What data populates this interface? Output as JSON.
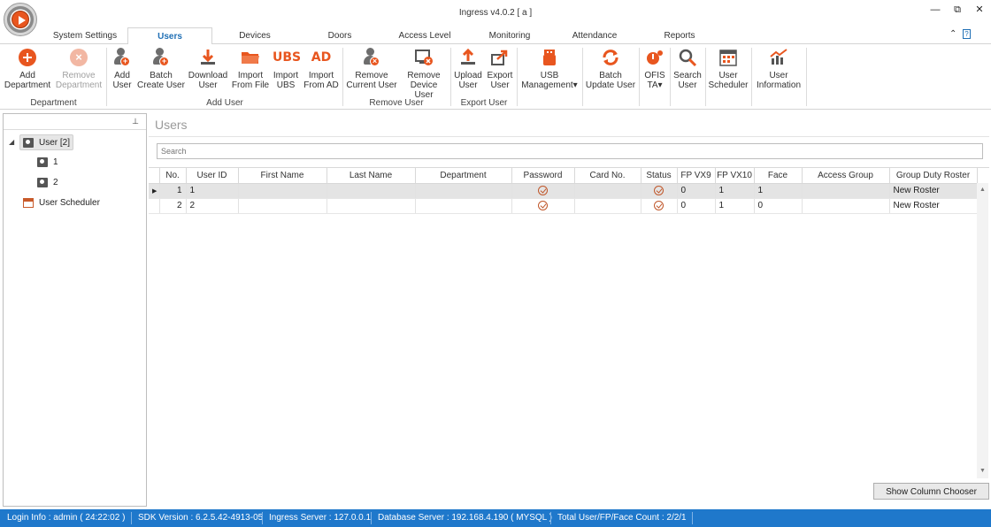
{
  "window": {
    "title": "Ingress v4.0.2 [ a ]",
    "controls": [
      "—",
      "⧉",
      "✕"
    ]
  },
  "tabs": [
    {
      "label": "System Settings",
      "active": false
    },
    {
      "label": "Users",
      "active": true
    },
    {
      "label": "Devices",
      "active": false
    },
    {
      "label": "Doors",
      "active": false
    },
    {
      "label": "Access Level",
      "active": false
    },
    {
      "label": "Monitoring",
      "active": false
    },
    {
      "label": "Attendance",
      "active": false
    },
    {
      "label": "Reports",
      "active": false
    }
  ],
  "tab_extras": {
    "collapse": "⌃",
    "help": "?"
  },
  "ribbon": {
    "groups": [
      {
        "label": "Department"
      },
      {
        "label": "Add User"
      },
      {
        "label": "Remove User"
      },
      {
        "label": "Export User"
      }
    ],
    "buttons": {
      "add_department": {
        "line1": "Add",
        "line2": "Department",
        "icon": "add-circle-icon"
      },
      "remove_department": {
        "line1": "Remove",
        "line2": "Department",
        "icon": "remove-circle-icon",
        "disabled": true
      },
      "add_user": {
        "line1": "Add",
        "line2": "User",
        "icon": "add-user-icon"
      },
      "batch_create_user": {
        "line1": "Batch",
        "line2": "Create User",
        "icon": "batch-create-user-icon"
      },
      "download_user": {
        "line1": "Download",
        "line2": "User",
        "icon": "download-icon"
      },
      "import_from_file": {
        "line1": "Import",
        "line2": "From File",
        "icon": "folder-icon"
      },
      "import_ubs": {
        "line1": "Import",
        "line2": "UBS",
        "icon": "ubs-icon",
        "icon_text": "UBS"
      },
      "import_from_ad": {
        "line1": "Import",
        "line2": "From AD",
        "icon": "active-directory-icon",
        "icon_text": "AD"
      },
      "remove_current_user": {
        "line1": "Remove",
        "line2": "Current User",
        "icon": "remove-user-icon"
      },
      "remove_device_user": {
        "line1": "Remove",
        "line2": "Device User",
        "icon": "remove-device-user-icon"
      },
      "upload_user": {
        "line1": "Upload",
        "line2": "User",
        "icon": "upload-icon"
      },
      "export_user": {
        "line1": "Export",
        "line2": "User",
        "icon": "export-icon"
      },
      "usb_management": {
        "line1": "USB",
        "line2": "Management▾",
        "icon": "usb-icon"
      },
      "batch_update_user": {
        "line1": "Batch",
        "line2": "Update User",
        "icon": "refresh-icon"
      },
      "ofis_ta": {
        "line1": "OFIS",
        "line2": "TA▾",
        "icon": "ofis-icon"
      },
      "search_user": {
        "line1": "Search",
        "line2": "User",
        "icon": "search-icon"
      },
      "user_scheduler": {
        "line1": "User",
        "line2": "Scheduler",
        "icon": "calendar-icon"
      },
      "user_information": {
        "line1": "User",
        "line2": "Information",
        "icon": "chart-icon"
      }
    }
  },
  "left_panel": {
    "pin_icon": "⊥",
    "tree": {
      "root": {
        "label": "User [2]",
        "expanded": true
      },
      "children": [
        {
          "label": "1"
        },
        {
          "label": "2"
        }
      ],
      "scheduler": {
        "label": "User Scheduler"
      }
    }
  },
  "main": {
    "title": "Users",
    "search": {
      "placeholder": "Search",
      "value": ""
    },
    "columns": [
      "No.",
      "User ID",
      "First Name",
      "Last Name",
      "Department",
      "Password",
      "Card No.",
      "Status",
      "FP VX9",
      "FP VX10",
      "Face",
      "Access Group",
      "Group Duty Roster"
    ],
    "rows": [
      {
        "no": "1",
        "user_id": "1",
        "first_name": "",
        "last_name": "",
        "department": "",
        "password": true,
        "card_no": "",
        "status": true,
        "fp_vx9": "0",
        "fp_vx10": "1",
        "face": "1",
        "access_group": "",
        "group_duty_roster": "New Roster",
        "selected": true
      },
      {
        "no": "2",
        "user_id": "2",
        "first_name": "",
        "last_name": "",
        "department": "",
        "password": true,
        "card_no": "",
        "status": true,
        "fp_vx9": "0",
        "fp_vx10": "1",
        "face": "0",
        "access_group": "",
        "group_duty_roster": "New Roster",
        "selected": false
      }
    ],
    "column_chooser_label": "Show Column Chooser"
  },
  "status_bar": {
    "login_info": "Login Info : admin ( 24:22:02 )",
    "sdk_version": "SDK Version : 6.2.5.42-4913-05",
    "ingress_server": "Ingress Server : 127.0.0.1",
    "database_server": "Database Server : 192.168.4.190 ( MYSQL )",
    "total_count": "Total User/FP/Face Count : 2/2/1"
  },
  "colors": {
    "accent": "#1f6fb5",
    "status_bar": "#1f78cb",
    "icon_orange": "#e8561f",
    "selected_row": "#e4e4e4"
  }
}
